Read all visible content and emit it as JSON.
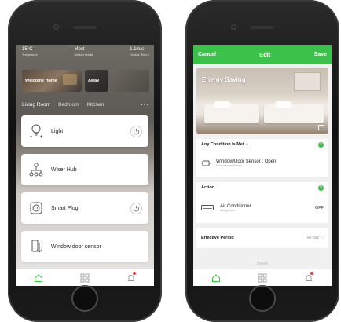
{
  "left_phone": {
    "weather": [
      {
        "value": "15°C",
        "label": "Temperature"
      },
      {
        "value": "Most",
        "label": "Outdoor Humid"
      },
      {
        "value": "1.1m/s",
        "label": "Outdoor Wind S"
      }
    ],
    "scenes": [
      {
        "label": "Welcome Home"
      },
      {
        "label": "Away"
      },
      {
        "label": ""
      }
    ],
    "rooms": [
      "Living Room",
      "Bedroom",
      "Kitchen"
    ],
    "more_label": "···",
    "devices": [
      {
        "name": "Light",
        "icon": "bulb-icon",
        "has_power": true
      },
      {
        "name": "Wiser Hub",
        "icon": "hub-icon",
        "has_power": false
      },
      {
        "name": "Smart Plug",
        "icon": "plug-icon",
        "has_power": true
      },
      {
        "name": "Window door sensor",
        "icon": "door-sensor-icon",
        "has_power": false
      }
    ],
    "tabbar": [
      "home-icon",
      "grid-icon",
      "bell-icon"
    ]
  },
  "right_phone": {
    "topbar": {
      "cancel": "Cancel",
      "title": "Edit",
      "save": "Save"
    },
    "scene_title": "Energy Saving",
    "condition": {
      "header": "Any Condition Is Met",
      "item_title": "Window/Door Sensor : Open",
      "item_sub": "Door Window Sensor"
    },
    "action": {
      "header": "Action",
      "item_title": "Air Conditioner",
      "item_sub": "Living Room",
      "item_value": "OFF"
    },
    "effective": {
      "label": "Effective Period",
      "value": "All-day"
    },
    "delete_label": "Delete",
    "tabbar": [
      "home-icon",
      "grid-icon",
      "bell-icon"
    ]
  },
  "colors": {
    "accent": "#3cc14a",
    "alert": "#e53935"
  }
}
